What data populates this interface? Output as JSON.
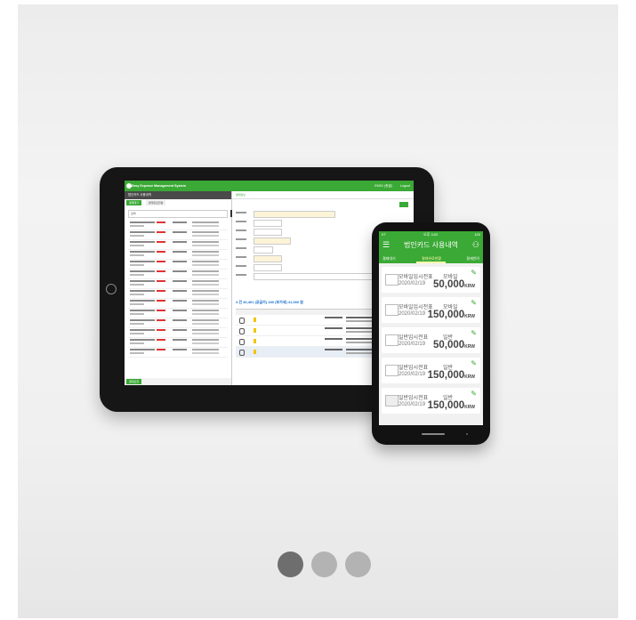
{
  "tablet": {
    "app_title": "Easy Expense Management System",
    "user": "EMS1 (총괄)",
    "logout": "Logout",
    "left_header": "법인카드 사용내역",
    "left_tabs": [
      "결재대기",
      "결재완료현황"
    ],
    "search_label": "검색",
    "right_header": "결재정보",
    "summary": "4 건  46,401 (공급가)   180 (부가세)   41,000 원",
    "footer_tab": "결재요청"
  },
  "phone": {
    "status_left": "KT",
    "status_time": "오후 3:02",
    "status_right": "100",
    "title": "법인카드 사용내역",
    "menu_icon": "menu-icon",
    "user_icon": "users-icon",
    "tabs": [
      "결재대기",
      "결재완료현황",
      "결재반려"
    ],
    "active_tab_index": 1,
    "items": [
      {
        "name": "모바일임시전표",
        "date": "2020/02/19",
        "type": "모바일",
        "amount": "50,000",
        "currency": "KRW"
      },
      {
        "name": "모바일임시전표",
        "date": "2020/02/19",
        "type": "모바일",
        "amount": "150,000",
        "currency": "KRW"
      },
      {
        "name": "일반임시전표",
        "date": "2020/02/19",
        "type": "일반",
        "amount": "50,000",
        "currency": "KRW"
      },
      {
        "name": "일반임시전표",
        "date": "2020/02/19",
        "type": "일반",
        "amount": "150,000",
        "currency": "KRW"
      },
      {
        "name": "일반임시전표",
        "date": "2020/02/19",
        "type": "일반",
        "amount": "150,000",
        "currency": "KRW"
      }
    ]
  },
  "carousel": {
    "page_count": 3,
    "active_index": 0
  },
  "colors": {
    "brand": "#3aa935",
    "active_dot": "#6e6e6e",
    "inactive_dot": "#b3b3b3"
  }
}
